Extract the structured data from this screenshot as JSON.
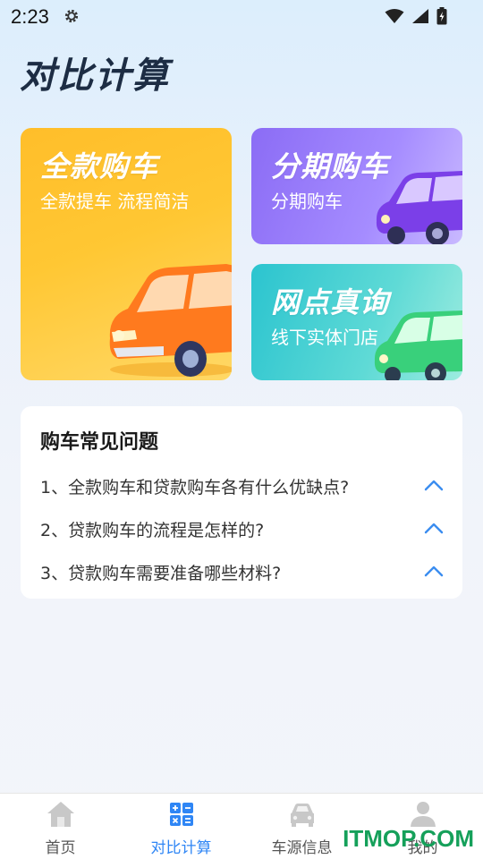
{
  "status_bar": {
    "time": "2:23"
  },
  "page": {
    "title": "对比计算"
  },
  "cards": {
    "full_payment": {
      "title": "全款购车",
      "subtitle": "全款提车 流程简洁"
    },
    "installment": {
      "title": "分期购车",
      "subtitle": "分期购车"
    },
    "store": {
      "title": "网点真询",
      "subtitle": "线下实体门店"
    }
  },
  "faq": {
    "title": "购车常见问题",
    "items": [
      {
        "question": "1、全款购车和贷款购车各有什么优缺点?"
      },
      {
        "question": "2、贷款购车的流程是怎样的?"
      },
      {
        "question": "3、贷款购车需要准备哪些材料?"
      }
    ]
  },
  "bottom_nav": {
    "items": [
      {
        "label": "首页",
        "icon": "home-icon"
      },
      {
        "label": "对比计算",
        "icon": "calculator-icon",
        "active": true
      },
      {
        "label": "车源信息",
        "icon": "car-icon"
      },
      {
        "label": "我的",
        "icon": "user-icon"
      }
    ]
  },
  "watermark": "ITMOP.COM",
  "colors": {
    "accent": "#2f86f5",
    "orange": "#ffc12e",
    "purple": "#9b7cf9",
    "teal": "#43d0d2"
  }
}
